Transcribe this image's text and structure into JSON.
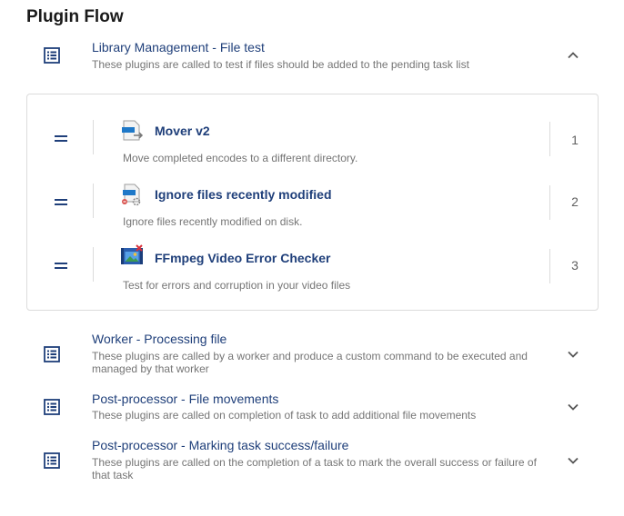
{
  "page": {
    "title": "Plugin Flow"
  },
  "sections": [
    {
      "title": "Library Management - File test",
      "description": "These plugins are called to test if files should be added to the pending task list",
      "expanded": true,
      "icon": "list-icon",
      "toggle_icon": "chevron-up-icon"
    },
    {
      "title": "Worker - Processing file",
      "description": "These plugins are called by a worker and produce a custom command to be executed and managed by that worker",
      "expanded": false,
      "icon": "list-icon",
      "toggle_icon": "chevron-down-icon"
    },
    {
      "title": "Post-processor - File movements",
      "description": "These plugins are called on completion of task to add additional file movements",
      "expanded": false,
      "icon": "list-icon",
      "toggle_icon": "chevron-down-icon"
    },
    {
      "title": "Post-processor - Marking task success/failure",
      "description": "These plugins are called on the completion of a task to mark the overall success or failure of that task",
      "expanded": false,
      "icon": "list-icon",
      "toggle_icon": "chevron-down-icon"
    }
  ],
  "plugins": [
    {
      "name": "Mover v2",
      "description": "Move completed encodes to a different directory.",
      "order": "1",
      "icon": "file-move-icon"
    },
    {
      "name": "Ignore files recently modified",
      "description": "Ignore files recently modified on disk.",
      "order": "2",
      "icon": "file-settings-icon"
    },
    {
      "name": "FFmpeg Video Error Checker",
      "description": "Test for errors and corruption in your video files",
      "order": "3",
      "icon": "video-film-icon"
    }
  ],
  "colors": {
    "accent": "#1f3f7a",
    "muted_text": "#757575",
    "border": "#dcdcdc"
  }
}
